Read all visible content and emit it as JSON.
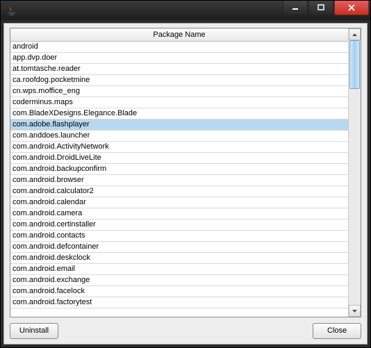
{
  "window": {
    "title": ""
  },
  "table": {
    "header": "Package Name",
    "selected_index": 7,
    "rows": [
      "android",
      "app.dvp.doer",
      "at.tomtasche.reader",
      "ca.roofdog.pocketmine",
      "cn.wps.moffice_eng",
      "coderminus.maps",
      "com.BladeXDesigns.Elegance.Blade",
      "com.adobe.flashplayer",
      "com.anddoes.launcher",
      "com.android.ActivityNetwork",
      "com.android.DroidLiveLite",
      "com.android.backupconfirm",
      "com.android.browser",
      "com.android.calculator2",
      "com.android.calendar",
      "com.android.camera",
      "com.android.certinstaller",
      "com.android.contacts",
      "com.android.defcontainer",
      "com.android.deskclock",
      "com.android.email",
      "com.android.exchange",
      "com.android.facelock",
      "com.android.factorytest"
    ]
  },
  "buttons": {
    "uninstall": "Uninstall",
    "close": "Close"
  }
}
